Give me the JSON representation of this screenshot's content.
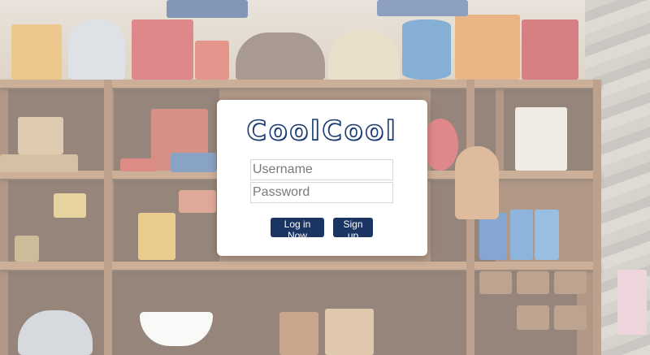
{
  "app": {
    "logo_text": "CoolCool"
  },
  "login_form": {
    "username_placeholder": "Username",
    "password_placeholder": "Password",
    "username_value": "",
    "password_value": ""
  },
  "buttons": {
    "login_label": "Log in Now",
    "signup_label": "Sign up"
  },
  "colors": {
    "brand": "#1a3b73",
    "button": "#1b3563",
    "card": "#ffffff"
  }
}
